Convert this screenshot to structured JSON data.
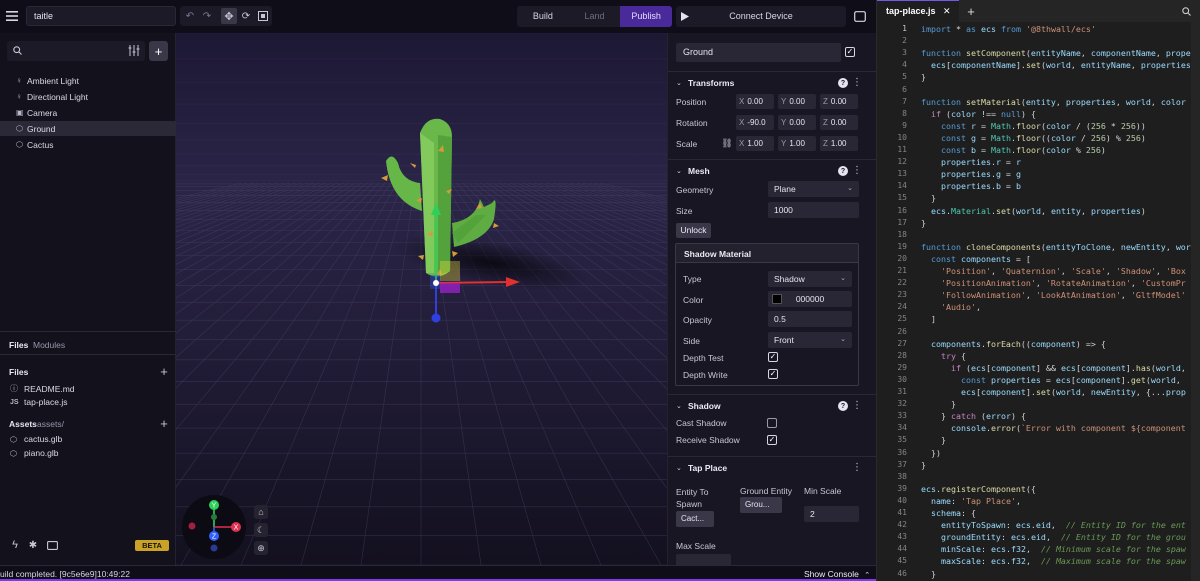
{
  "app": {
    "project_title": "taitle"
  },
  "modes": {
    "build": "Build",
    "land": "Land",
    "publish": "Publish"
  },
  "connect": {
    "label": "Connect Device"
  },
  "hierarchy": {
    "items": [
      {
        "label": "Ambient Light",
        "icon": "lightbulb-icon"
      },
      {
        "label": "Directional Light",
        "icon": "lightbulb-icon"
      },
      {
        "label": "Camera",
        "icon": "camera-icon"
      },
      {
        "label": "Ground",
        "icon": "cube-icon"
      },
      {
        "label": "Cactus",
        "icon": "cube-icon"
      }
    ]
  },
  "file_tabs": {
    "files": "Files",
    "modules": "Modules"
  },
  "files": {
    "heading": "Files",
    "items": [
      {
        "label": "README.md",
        "icon": "info-icon"
      },
      {
        "label": "tap-place.js",
        "icon": "js-icon"
      }
    ]
  },
  "assets": {
    "heading": "Assets",
    "path": "assets/",
    "items": [
      {
        "label": "cactus.glb",
        "icon": "cube-icon"
      },
      {
        "label": "piano.glb",
        "icon": "cube-icon"
      }
    ]
  },
  "beta_badge": "BETA",
  "inspector": {
    "entity_name": "Ground",
    "transforms": {
      "title": "Transforms",
      "position_label": "Position",
      "rotation_label": "Rotation",
      "scale_label": "Scale",
      "position": {
        "x": "0.00",
        "y": "0.00",
        "z": "0.00"
      },
      "rotation": {
        "x": "-90.0",
        "y": "0.00",
        "z": "0.00"
      },
      "scale": {
        "x": "1.00",
        "y": "1.00",
        "z": "1.00"
      }
    },
    "mesh": {
      "title": "Mesh",
      "geometry_label": "Geometry",
      "geometry_value": "Plane",
      "size_label": "Size",
      "size_value": "1000",
      "unlock_button": "Unlock",
      "material": {
        "title": "Shadow Material",
        "type_label": "Type",
        "type_value": "Shadow",
        "color_label": "Color",
        "color_value": "000000",
        "opacity_label": "Opacity",
        "opacity_value": "0.5",
        "side_label": "Side",
        "side_value": "Front",
        "depth_test_label": "Depth Test",
        "depth_write_label": "Depth Write"
      }
    },
    "shadow": {
      "title": "Shadow",
      "cast_label": "Cast Shadow",
      "receive_label": "Receive Shadow"
    },
    "tap_place": {
      "title": "Tap Place",
      "entity_to_spawn_label": "Entity To Spawn",
      "entity_to_spawn_value": "Cact...",
      "ground_entity_label": "Ground Entity",
      "ground_entity_value": "Grou...",
      "min_scale_label": "Min Scale",
      "min_scale_value": "2",
      "max_scale_label": "Max Scale"
    }
  },
  "status": {
    "message": "uild completed. [9c5e6e9]10:49:22",
    "show_console": "Show Console"
  },
  "editor": {
    "tab_label": "tap-place.js",
    "lines": [
      "import * as ecs from '@8thwall/ecs'",
      "",
      "function setComponent(entityName, componentName, prope",
      "  ecs[componentName].set(world, entityName, properties",
      "}",
      "",
      "function setMaterial(entity, properties, world, color",
      "  if (color !== null) {",
      "    const r = Math.floor(color / (256 * 256))",
      "    const g = Math.floor((color / 256) % 256)",
      "    const b = Math.floor(color % 256)",
      "    properties.r = r",
      "    properties.g = g",
      "    properties.b = b",
      "  }",
      "  ecs.Material.set(world, entity, properties)",
      "}",
      "",
      "function cloneComponents(entityToClone, newEntity, wor",
      "  const components = [",
      "    'Position', 'Quaternion', 'Scale', 'Shadow', 'Box",
      "    'PositionAnimation', 'RotateAnimation', 'CustomPr",
      "    'FollowAnimation', 'LookAtAnimation', 'GltfModel'",
      "    'Audio',",
      "  ]",
      "",
      "  components.forEach((component) => {",
      "    try {",
      "      if (ecs[component] && ecs[component].has(world,",
      "        const properties = ecs[component].get(world, ",
      "        ecs[component].set(world, newEntity, {...prop",
      "      }",
      "    } catch (error) {",
      "      console.error(`Error with component ${component",
      "    }",
      "  })",
      "}",
      "",
      "ecs.registerComponent({",
      "  name: 'Tap Place',",
      "  schema: {",
      "    entityToSpawn: ecs.eid,  // Entity ID for the ent",
      "    groundEntity: ecs.eid,  // Entity ID for the grou",
      "    minScale: ecs.f32,  // Minimum scale for the spaw",
      "    maxScale: ecs.f32,  // Maximum scale for the spaw",
      "  }"
    ]
  },
  "colors": {
    "accent": "#6c3fd1",
    "publish_bg": "#4a2a9a",
    "status_bar": "#7c3aed"
  }
}
